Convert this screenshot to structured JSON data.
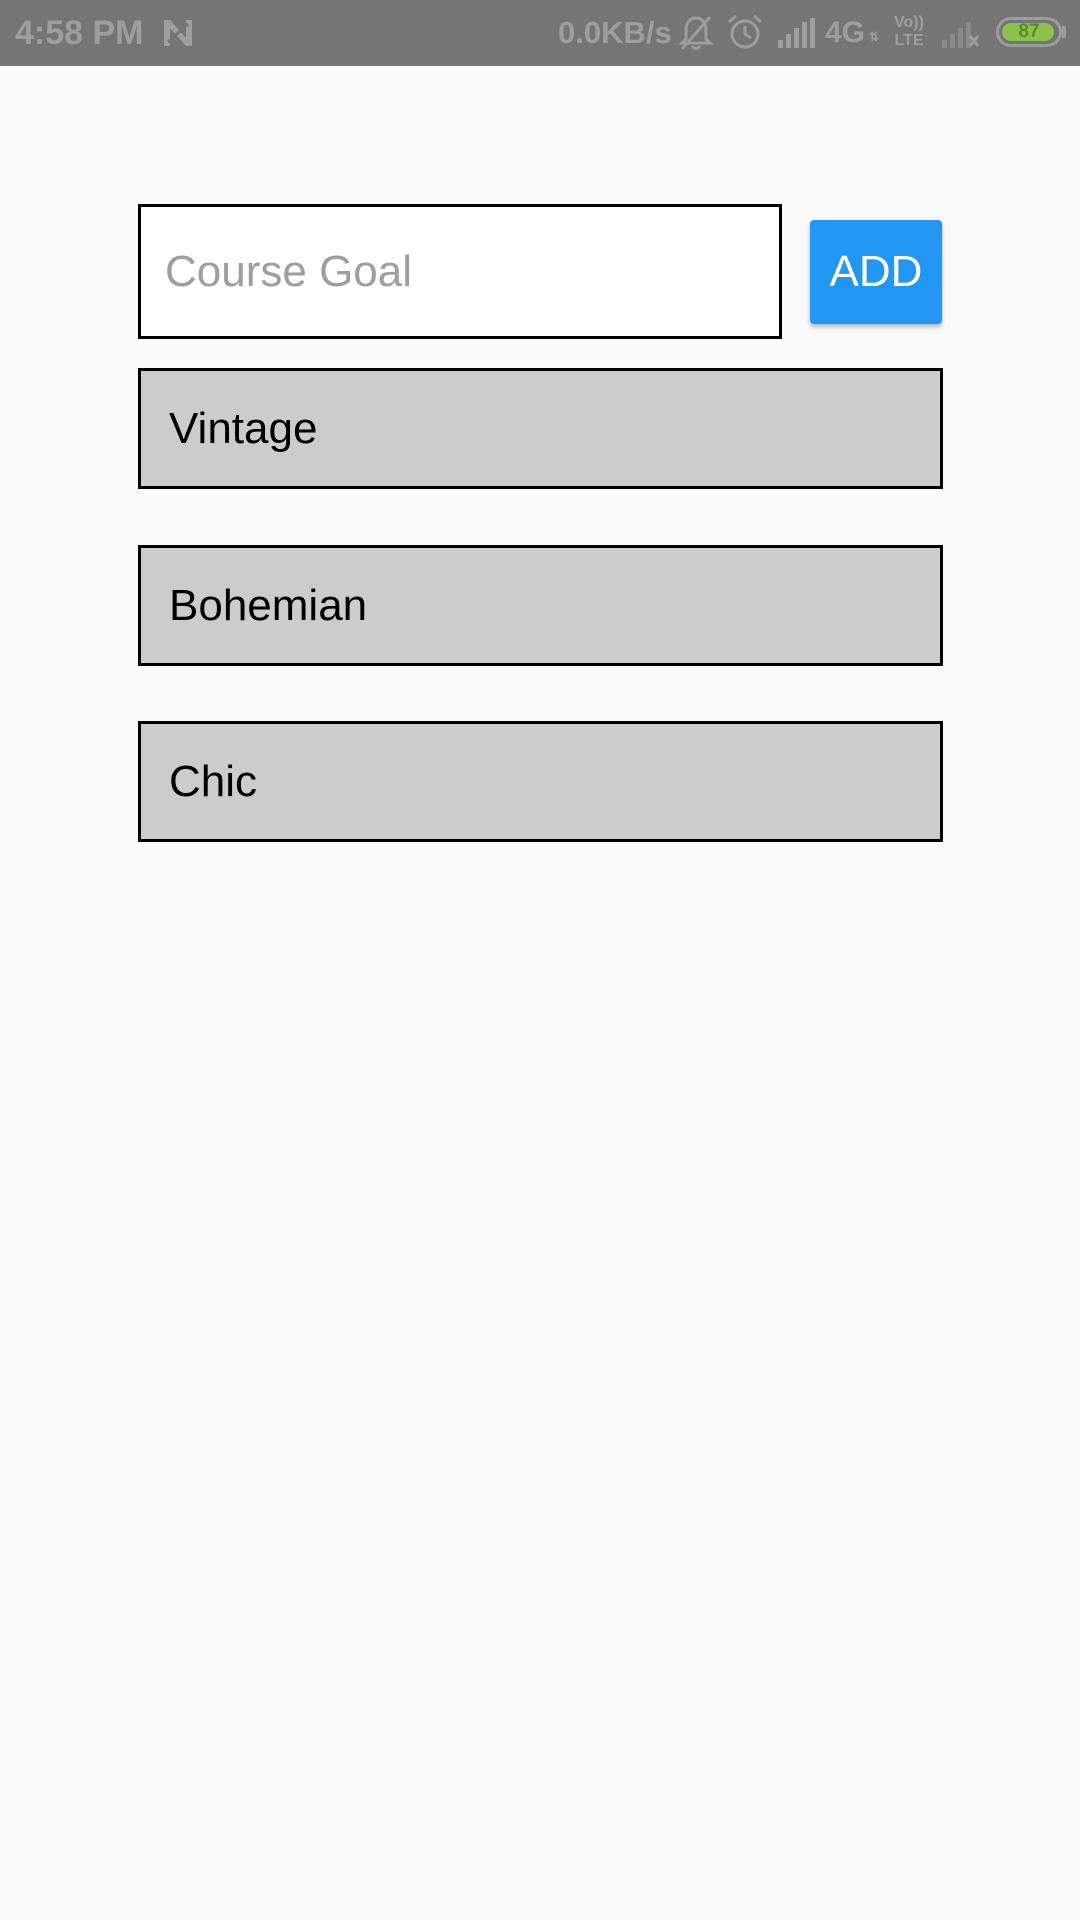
{
  "status_bar": {
    "time": "4:58 PM",
    "network_speed": "0.0KB/s",
    "network_type": "4G",
    "network_arrows": "⇅",
    "volte_line1": "Vo))",
    "volte_line2": "LTE",
    "battery_level": "87",
    "icons": [
      "n-notification-icon",
      "bell-muted-icon",
      "alarm-icon",
      "signal-strength-icon",
      "volte-icon",
      "signal-weak-icon",
      "battery-icon"
    ]
  },
  "goal_form": {
    "input_placeholder": "Course Goal",
    "input_value": "",
    "add_label": "ADD"
  },
  "goals": [
    {
      "label": "Vintage"
    },
    {
      "label": "Bohemian"
    },
    {
      "label": "Chic"
    }
  ],
  "colors": {
    "status_bar_bg": "#757575",
    "accent": "#2196f3",
    "list_item_bg": "#cccccc",
    "background": "#fafafa",
    "battery": "#8bc34a"
  }
}
